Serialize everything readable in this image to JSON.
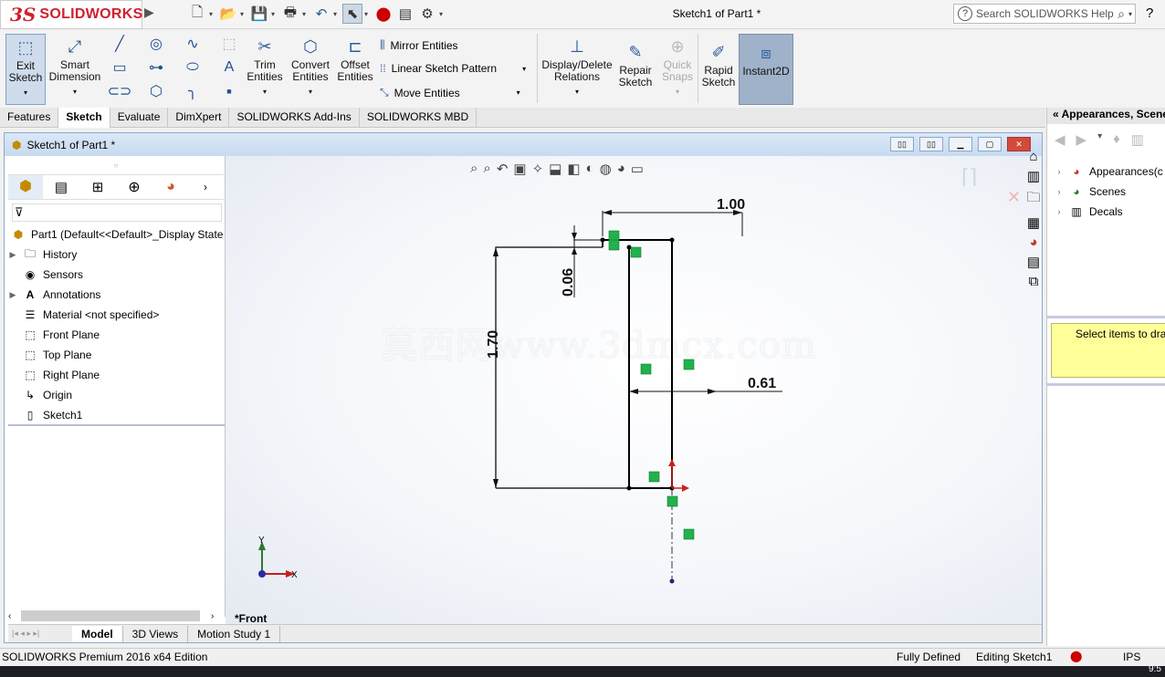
{
  "app": {
    "brand_prefix": "3S",
    "brand": "SOLIDWORKS",
    "document_title": "Sketch1 of Part1 *"
  },
  "search": {
    "placeholder": "Search SOLIDWORKS Help"
  },
  "commands": {
    "exit_sketch": "Exit\nSketch",
    "smart_dimension": "Smart\nDimension",
    "trim_entities": "Trim\nEntities",
    "convert_entities": "Convert\nEntities",
    "offset_entities": "Offset\nEntities",
    "mirror_entities": "Mirror Entities",
    "linear_pattern": "Linear Sketch Pattern",
    "move_entities": "Move Entities",
    "display_relations": "Display/Delete\nRelations",
    "repair_sketch": "Repair\nSketch",
    "quick_snaps": "Quick\nSnaps",
    "rapid_sketch": "Rapid\nSketch",
    "instant2d": "Instant2D"
  },
  "tabs": [
    "Features",
    "Sketch",
    "Evaluate",
    "DimXpert",
    "SOLIDWORKS Add-Ins",
    "SOLIDWORKS MBD"
  ],
  "active_tab": "Sketch",
  "document_window": {
    "title": "Sketch1 of Part1 *"
  },
  "tree": {
    "root": "Part1  (Default<<Default>_Display State",
    "items": [
      "History",
      "Sensors",
      "Annotations",
      "Material <not specified>",
      "Front Plane",
      "Top Plane",
      "Right Plane",
      "Origin",
      "Sketch1"
    ]
  },
  "viewport": {
    "view_label": "*Front",
    "watermark": "莫西网www.3dmcx.com",
    "dimensions": {
      "top_width": "1.00",
      "height": "1.70",
      "step": "0.06",
      "inner_width": "0.61"
    },
    "axis_x": "X",
    "axis_y": "Y"
  },
  "bottom_tabs": [
    "Model",
    "3D Views",
    "Motion Study 1"
  ],
  "active_bottom_tab": "Model",
  "right_panel": {
    "title": "Appearances, Scene",
    "items": [
      "Appearances(c",
      "Scenes",
      "Decals"
    ],
    "message": "Select items to dra"
  },
  "status": {
    "edition": "SOLIDWORKS Premium 2016 x64 Edition",
    "state": "Fully Defined",
    "editing": "Editing Sketch1",
    "units": "IPS",
    "time": "9:5"
  },
  "colors": {
    "accent": "#d0202e",
    "relation_green": "#22b14c",
    "dim_line": "#111111",
    "sketch_line": "#000000"
  }
}
